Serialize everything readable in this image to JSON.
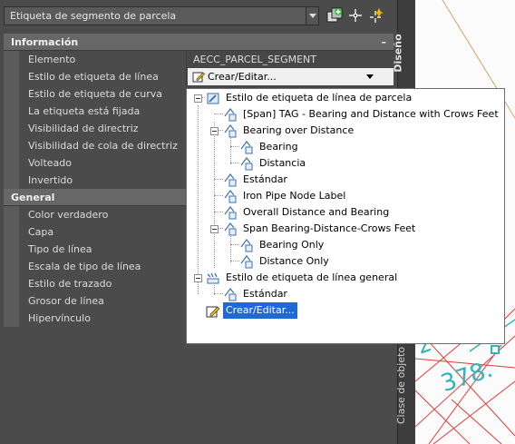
{
  "header": {
    "object_type": "Etiqueta de segmento de parcela"
  },
  "side_tabs": {
    "design": "Diseño",
    "object_class": "Clase de objeto"
  },
  "categories": {
    "info": {
      "title": "Información",
      "collapse": "–"
    },
    "general": {
      "title": "General"
    }
  },
  "properties": {
    "info": [
      {
        "name": "Elemento",
        "value": "AECC_PARCEL_SEGMENT"
      },
      {
        "name": "Estilo de etiqueta de línea",
        "value": "Crear/Editar..."
      },
      {
        "name": "Estilo de etiqueta de curva",
        "value": ""
      },
      {
        "name": "La etiqueta está fijada",
        "value": ""
      },
      {
        "name": "Visibilidad de directriz",
        "value": ""
      },
      {
        "name": "Visibilidad de cola de directriz",
        "value": ""
      },
      {
        "name": "Volteado",
        "value": ""
      },
      {
        "name": "Invertido",
        "value": ""
      }
    ],
    "general": [
      {
        "name": "Color verdadero",
        "value": ""
      },
      {
        "name": "Capa",
        "value": ""
      },
      {
        "name": "Tipo de línea",
        "value": ""
      },
      {
        "name": "Escala de tipo de línea",
        "value": ""
      },
      {
        "name": "Estilo de trazado",
        "value": ""
      },
      {
        "name": "Grosor de línea",
        "value": ""
      },
      {
        "name": "Hipervínculo",
        "value": ""
      }
    ]
  },
  "tree": {
    "root1": "Estilo de etiqueta de línea de parcela",
    "items": [
      "[Span] TAG - Bearing and Distance with Crows Feet",
      "Bearing over Distance",
      "Bearing",
      "Distancia",
      "Estándar",
      "Iron Pipe Node Label",
      "Overall Distance and Bearing",
      "Span Bearing-Distance-Crows Feet",
      "Bearing Only",
      "Distance Only"
    ],
    "root2": "Estilo de etiqueta de línea general",
    "root2_child": "Estándar",
    "create_edit": "Crear/Editar..."
  },
  "drawing": {
    "label_partial_1": "378.",
    "label_partial_2": "2"
  },
  "colors": {
    "accent_select": "#1e69d6",
    "drawing_text": "#2fb6b6",
    "grid_red": "#e23a3a"
  }
}
